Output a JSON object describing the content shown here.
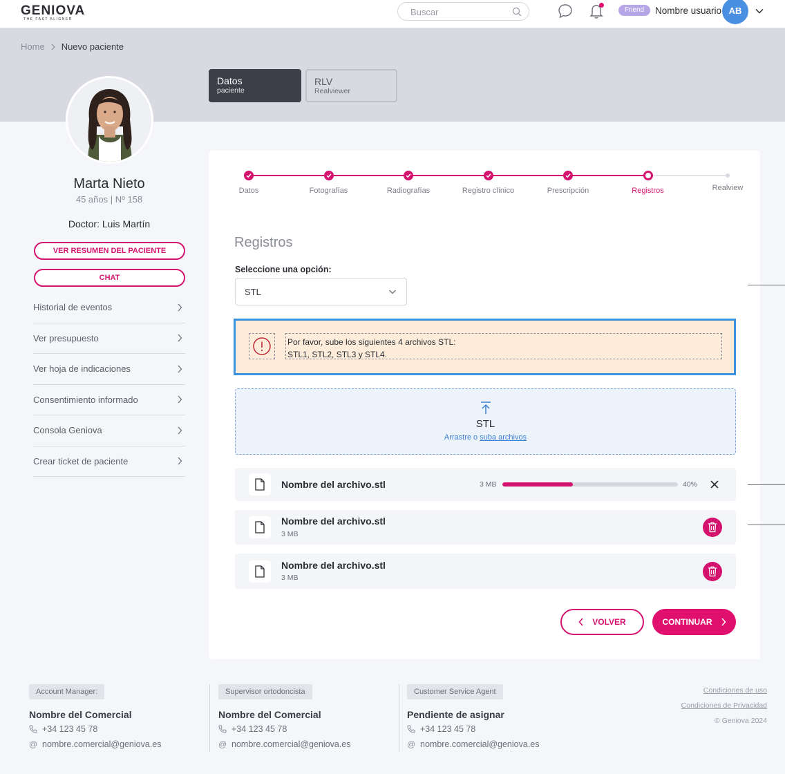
{
  "brand": {
    "logo": "GENIOVA",
    "tagline": "THE FAST ALIGNER"
  },
  "topbar": {
    "search_placeholder": "Buscar",
    "badge": "Friend",
    "username": "Nombre usuario",
    "avatar_initials": "AB"
  },
  "breadcrumb": {
    "home": "Home",
    "current": "Nuevo paciente"
  },
  "tabs": [
    {
      "title": "Datos",
      "subtitle": "paciente"
    },
    {
      "title": "RLV",
      "subtitle": "Realviewer"
    }
  ],
  "patient": {
    "name": "Marta Nieto",
    "meta": "45 años  |  Nº 158",
    "doctor": "Doctor: Luis Martín",
    "summary_button": "VER RESUMEN DEL PACIENTE",
    "chat_button": "CHAT"
  },
  "side_menu": [
    "Historial de eventos",
    "Ver presupuesto",
    "Ver hoja de indicaciones",
    "Consentimiento informado",
    "Consola Geniova",
    "Crear ticket de paciente"
  ],
  "stepper": {
    "steps": [
      "Datos",
      "Fotografías",
      "Radiografías",
      "Registro clínico",
      "Prescripción",
      "Registros",
      "Realview"
    ],
    "completed": 5,
    "current_index": 5
  },
  "section": {
    "title": "Registros",
    "select_label": "Seleccione una opción:",
    "select_value": "STL"
  },
  "alert": {
    "line1": "Por favor, sube los siguientes 4 archivos STL:",
    "line2": "STL1, STL2, STL3 y STL4."
  },
  "dropzone": {
    "title": "STL",
    "text": "Arrastre o",
    "link": "suba archivos"
  },
  "files": [
    {
      "name": "Nombre del archivo.stl",
      "size": "3 MB",
      "progress_text": "40%",
      "progress": 0.4,
      "status": "uploading"
    },
    {
      "name": "Nombre del archivo.stl",
      "size": "3 MB",
      "status": "done"
    },
    {
      "name": "Nombre del archivo.stl",
      "size": "3 MB",
      "status": "done"
    }
  ],
  "actions": {
    "back": "VOLVER",
    "continue": "CONTINUAR"
  },
  "footer": {
    "contacts": [
      {
        "role": "Account Manager:",
        "name": "Nombre del Comercial",
        "phone": "+34 123 45 78",
        "email": "nombre.comercial@geniova.es"
      },
      {
        "role": "Supervisor ortodoncista",
        "name": "Nombre del Comercial",
        "phone": "+34 123 45 78",
        "email": "nombre.comercial@geniova.es"
      },
      {
        "role": "Customer Service Agent",
        "name": "Pendiente de asignar",
        "phone": "+34 123 45 78",
        "email": "nombre.comercial@geniova.es"
      }
    ],
    "terms": "Condiciones de uso",
    "privacy": "Condiciones de Privacidad",
    "copyright": "© Geniova 2024"
  },
  "colors": {
    "accent": "#d4136e",
    "focus": "#3b93e0",
    "alert_bg": "#fcecd9",
    "avatar": "#4a90e2"
  }
}
